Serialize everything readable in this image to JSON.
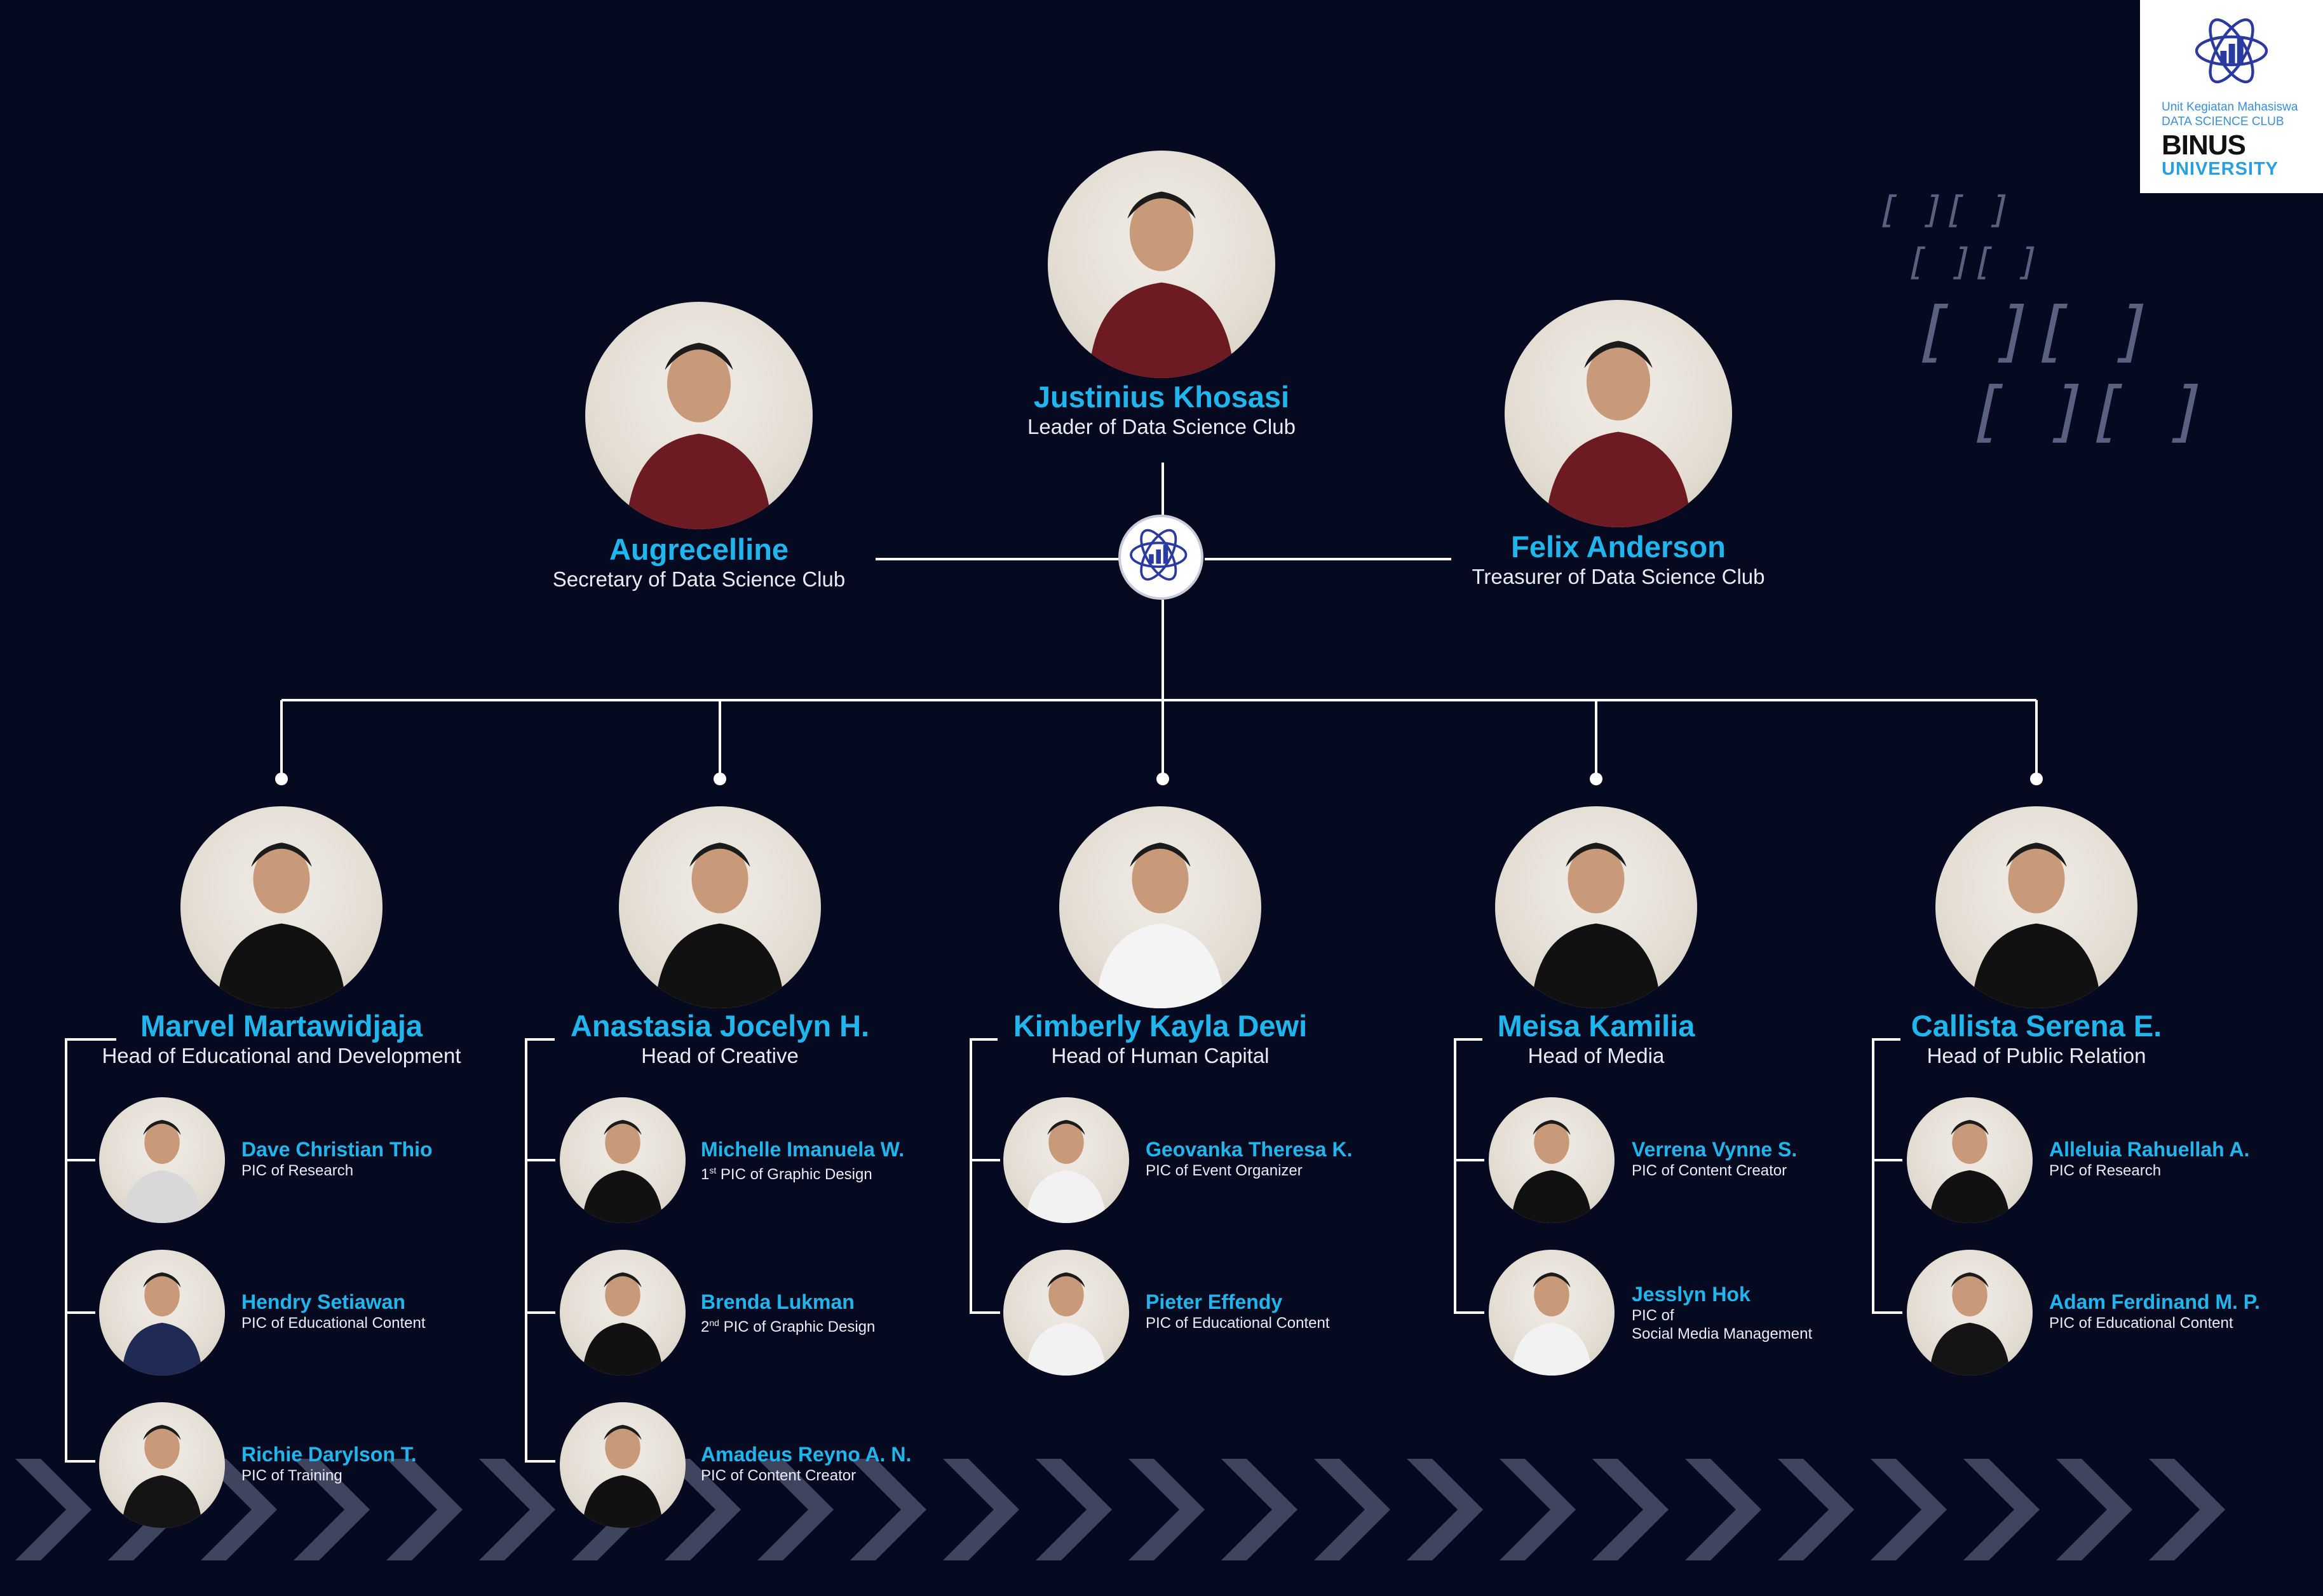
{
  "top": {
    "leader": {
      "name": "Justinius Khosasi",
      "role": "Leader of Data Science Club"
    },
    "secretary": {
      "name": "Augrecelline",
      "role": "Secretary of Data Science Club"
    },
    "treasurer": {
      "name": "Felix Anderson",
      "role": "Treasurer of Data Science Club"
    }
  },
  "divisions": [
    {
      "head": {
        "name": "Marvel Martawidjaja",
        "role": "Head of Educational and Development"
      },
      "members": [
        {
          "name": "Dave Christian Thio",
          "role": "PIC of Research"
        },
        {
          "name": "Hendry Setiawan",
          "role": "PIC of Educational Content"
        },
        {
          "name": "Richie Darylson T.",
          "role": "PIC of Training"
        }
      ]
    },
    {
      "head": {
        "name": "Anastasia Jocelyn H.",
        "role": "Head of Creative"
      },
      "members": [
        {
          "name": "Michelle Imanuela W.",
          "role_prefix": "1",
          "role_sup": "st",
          "role": " PIC of Graphic Design"
        },
        {
          "name": "Brenda Lukman",
          "role_prefix": "2",
          "role_sup": "nd",
          "role": " PIC of Graphic Design"
        },
        {
          "name": "Amadeus Reyno A. N.",
          "role": "PIC of Content Creator"
        }
      ]
    },
    {
      "head": {
        "name": "Kimberly Kayla Dewi",
        "role": "Head of Human Capital"
      },
      "members": [
        {
          "name": "Geovanka Theresa K.",
          "role": "PIC of Event Organizer"
        },
        {
          "name": "Pieter Effendy",
          "role": "PIC of Educational Content"
        }
      ]
    },
    {
      "head": {
        "name": "Meisa Kamilia",
        "role": "Head of Media"
      },
      "members": [
        {
          "name": "Verrena Vynne S.",
          "role": "PIC of Content Creator"
        },
        {
          "name": "Jesslyn Hok",
          "role": "PIC of",
          "role2": "Social Media Management"
        }
      ]
    },
    {
      "head": {
        "name": "Callista Serena E.",
        "role": "Head of Public Relation"
      },
      "members": [
        {
          "name": "Alleluia Rahuellah A.",
          "role": "PIC of Research"
        },
        {
          "name": "Adam Ferdinand M. P.",
          "role": "PIC of Educational Content"
        }
      ]
    }
  ],
  "logo": {
    "line1": "Unit Kegiatan Mahasiswa",
    "line2": "DATA SCIENCE CLUB",
    "line3": "BINUS",
    "line4": "UNIVERSITY"
  },
  "decorative": {
    "brackets": "[ ][ ]",
    "chevron_icon": "chevron-right-icon"
  },
  "colors": {
    "background": "#060a20",
    "name_accent": "#1fb6ee",
    "line": "#ffffff",
    "chevron": "#4a4f6b",
    "logo_blue": "#2b3a9e"
  }
}
